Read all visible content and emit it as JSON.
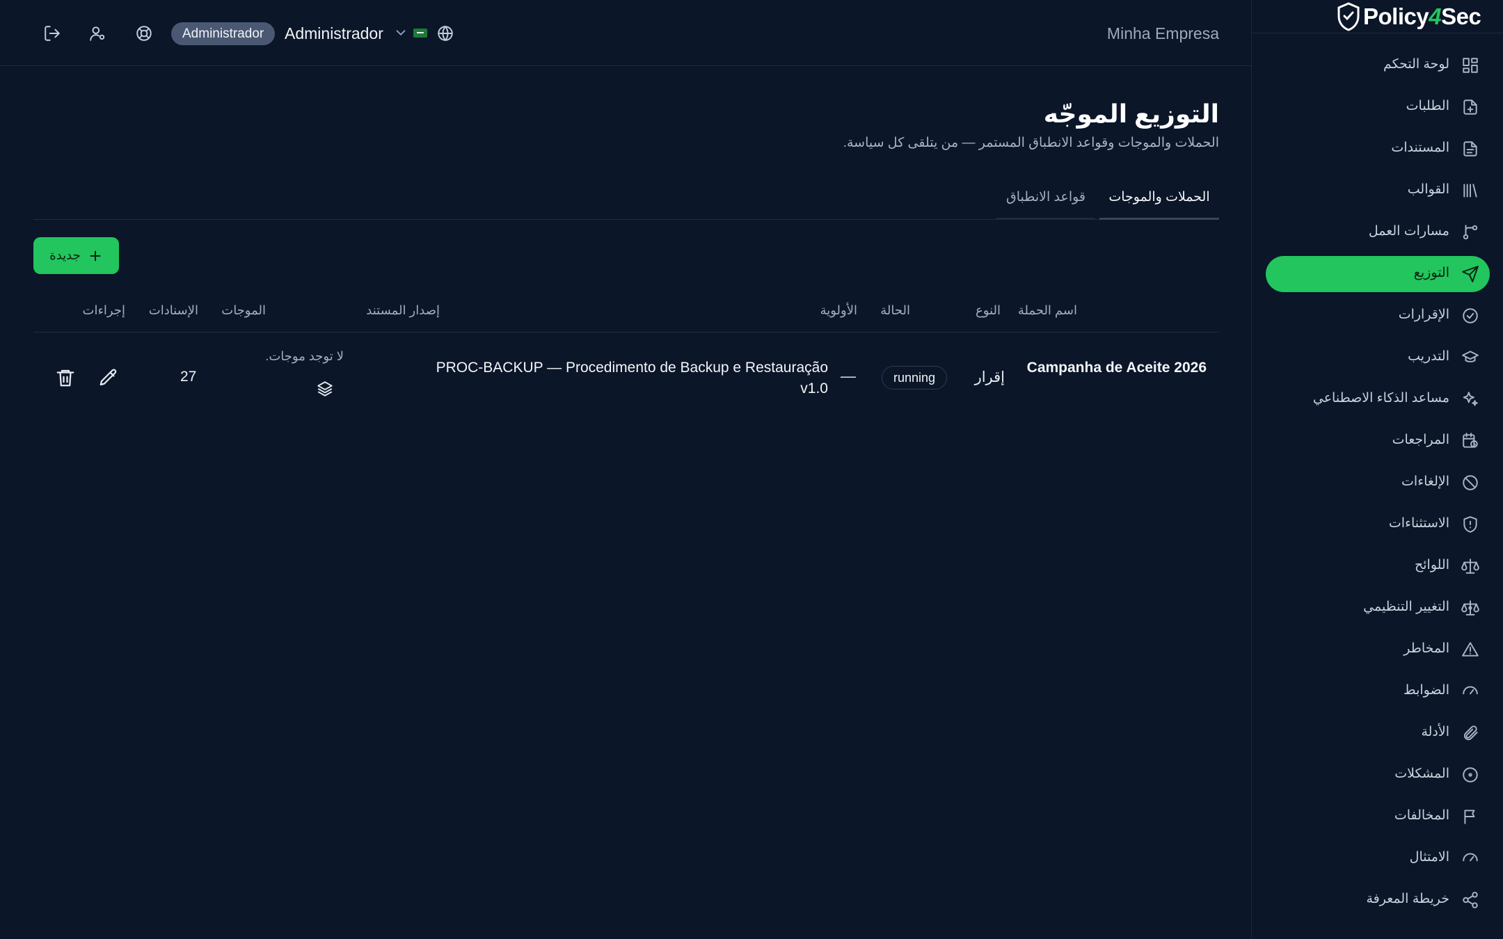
{
  "header": {
    "role_badge": "Administrador",
    "user_name": "Administrador",
    "company": "Minha Empresa"
  },
  "brand": {
    "name_left": "Policy",
    "name_four": "4",
    "name_right": "Sec"
  },
  "page": {
    "title": "التوزيع الموجّه",
    "subtitle": "الحملات والموجات وقواعد الانطباق المستمر — من يتلقى كل سياسة."
  },
  "tabs": [
    {
      "label": "الحملات والموجات",
      "active": true
    },
    {
      "label": "قواعد الانطباق",
      "active": false
    }
  ],
  "new_button": {
    "label": "جديدة"
  },
  "table": {
    "columns": {
      "name": "اسم الحملة",
      "type": "النوع",
      "status": "الحالة",
      "priority": "الأولوية",
      "doc_version": "إصدار المستند",
      "waves": "الموجات",
      "assignments": "الإسنادات",
      "actions": "إجراءات"
    },
    "rows": [
      {
        "name": "Campanha de Aceite 2026",
        "type": "إقرار",
        "status": "running",
        "priority": "—",
        "doc_version": "PROC-BACKUP — Procedimento de Backup e Restauração v1.0",
        "waves": "لا توجد موجات.",
        "assignments": "27"
      }
    ]
  },
  "sidebar": {
    "items": [
      {
        "label": "لوحة التحكم",
        "icon": "dashboard-icon"
      },
      {
        "label": "الطلبات",
        "icon": "file-plus-icon"
      },
      {
        "label": "المستندات",
        "icon": "file-text-icon"
      },
      {
        "label": "القوالب",
        "icon": "library-icon"
      },
      {
        "label": "مسارات العمل",
        "icon": "workflow-icon"
      },
      {
        "label": "التوزيع",
        "icon": "send-icon",
        "active": true
      },
      {
        "label": "الإقرارات",
        "icon": "check-circle-icon"
      },
      {
        "label": "التدريب",
        "icon": "graduation-cap-icon"
      },
      {
        "label": "مساعد الذكاء الاصطناعي",
        "icon": "sparkles-icon"
      },
      {
        "label": "المراجعات",
        "icon": "calendar-clock-icon"
      },
      {
        "label": "الإلغاءات",
        "icon": "ban-icon"
      },
      {
        "label": "الاستثناءات",
        "icon": "shield-alert-icon"
      },
      {
        "label": "اللوائح",
        "icon": "scale-icon"
      },
      {
        "label": "التغيير التنظيمي",
        "icon": "scale-change-icon"
      },
      {
        "label": "المخاطر",
        "icon": "warning-icon"
      },
      {
        "label": "الضوابط",
        "icon": "gauge-icon"
      },
      {
        "label": "الأدلة",
        "icon": "paperclip-icon"
      },
      {
        "label": "المشكلات",
        "icon": "circle-dot-icon"
      },
      {
        "label": "المخالفات",
        "icon": "flag-icon"
      },
      {
        "label": "الامتثال",
        "icon": "gauge-icon"
      },
      {
        "label": "خريطة المعرفة",
        "icon": "share-icon"
      }
    ]
  },
  "colors": {
    "accent": "#22c55e",
    "background": "#0b1628",
    "badge": "#4a5873"
  }
}
